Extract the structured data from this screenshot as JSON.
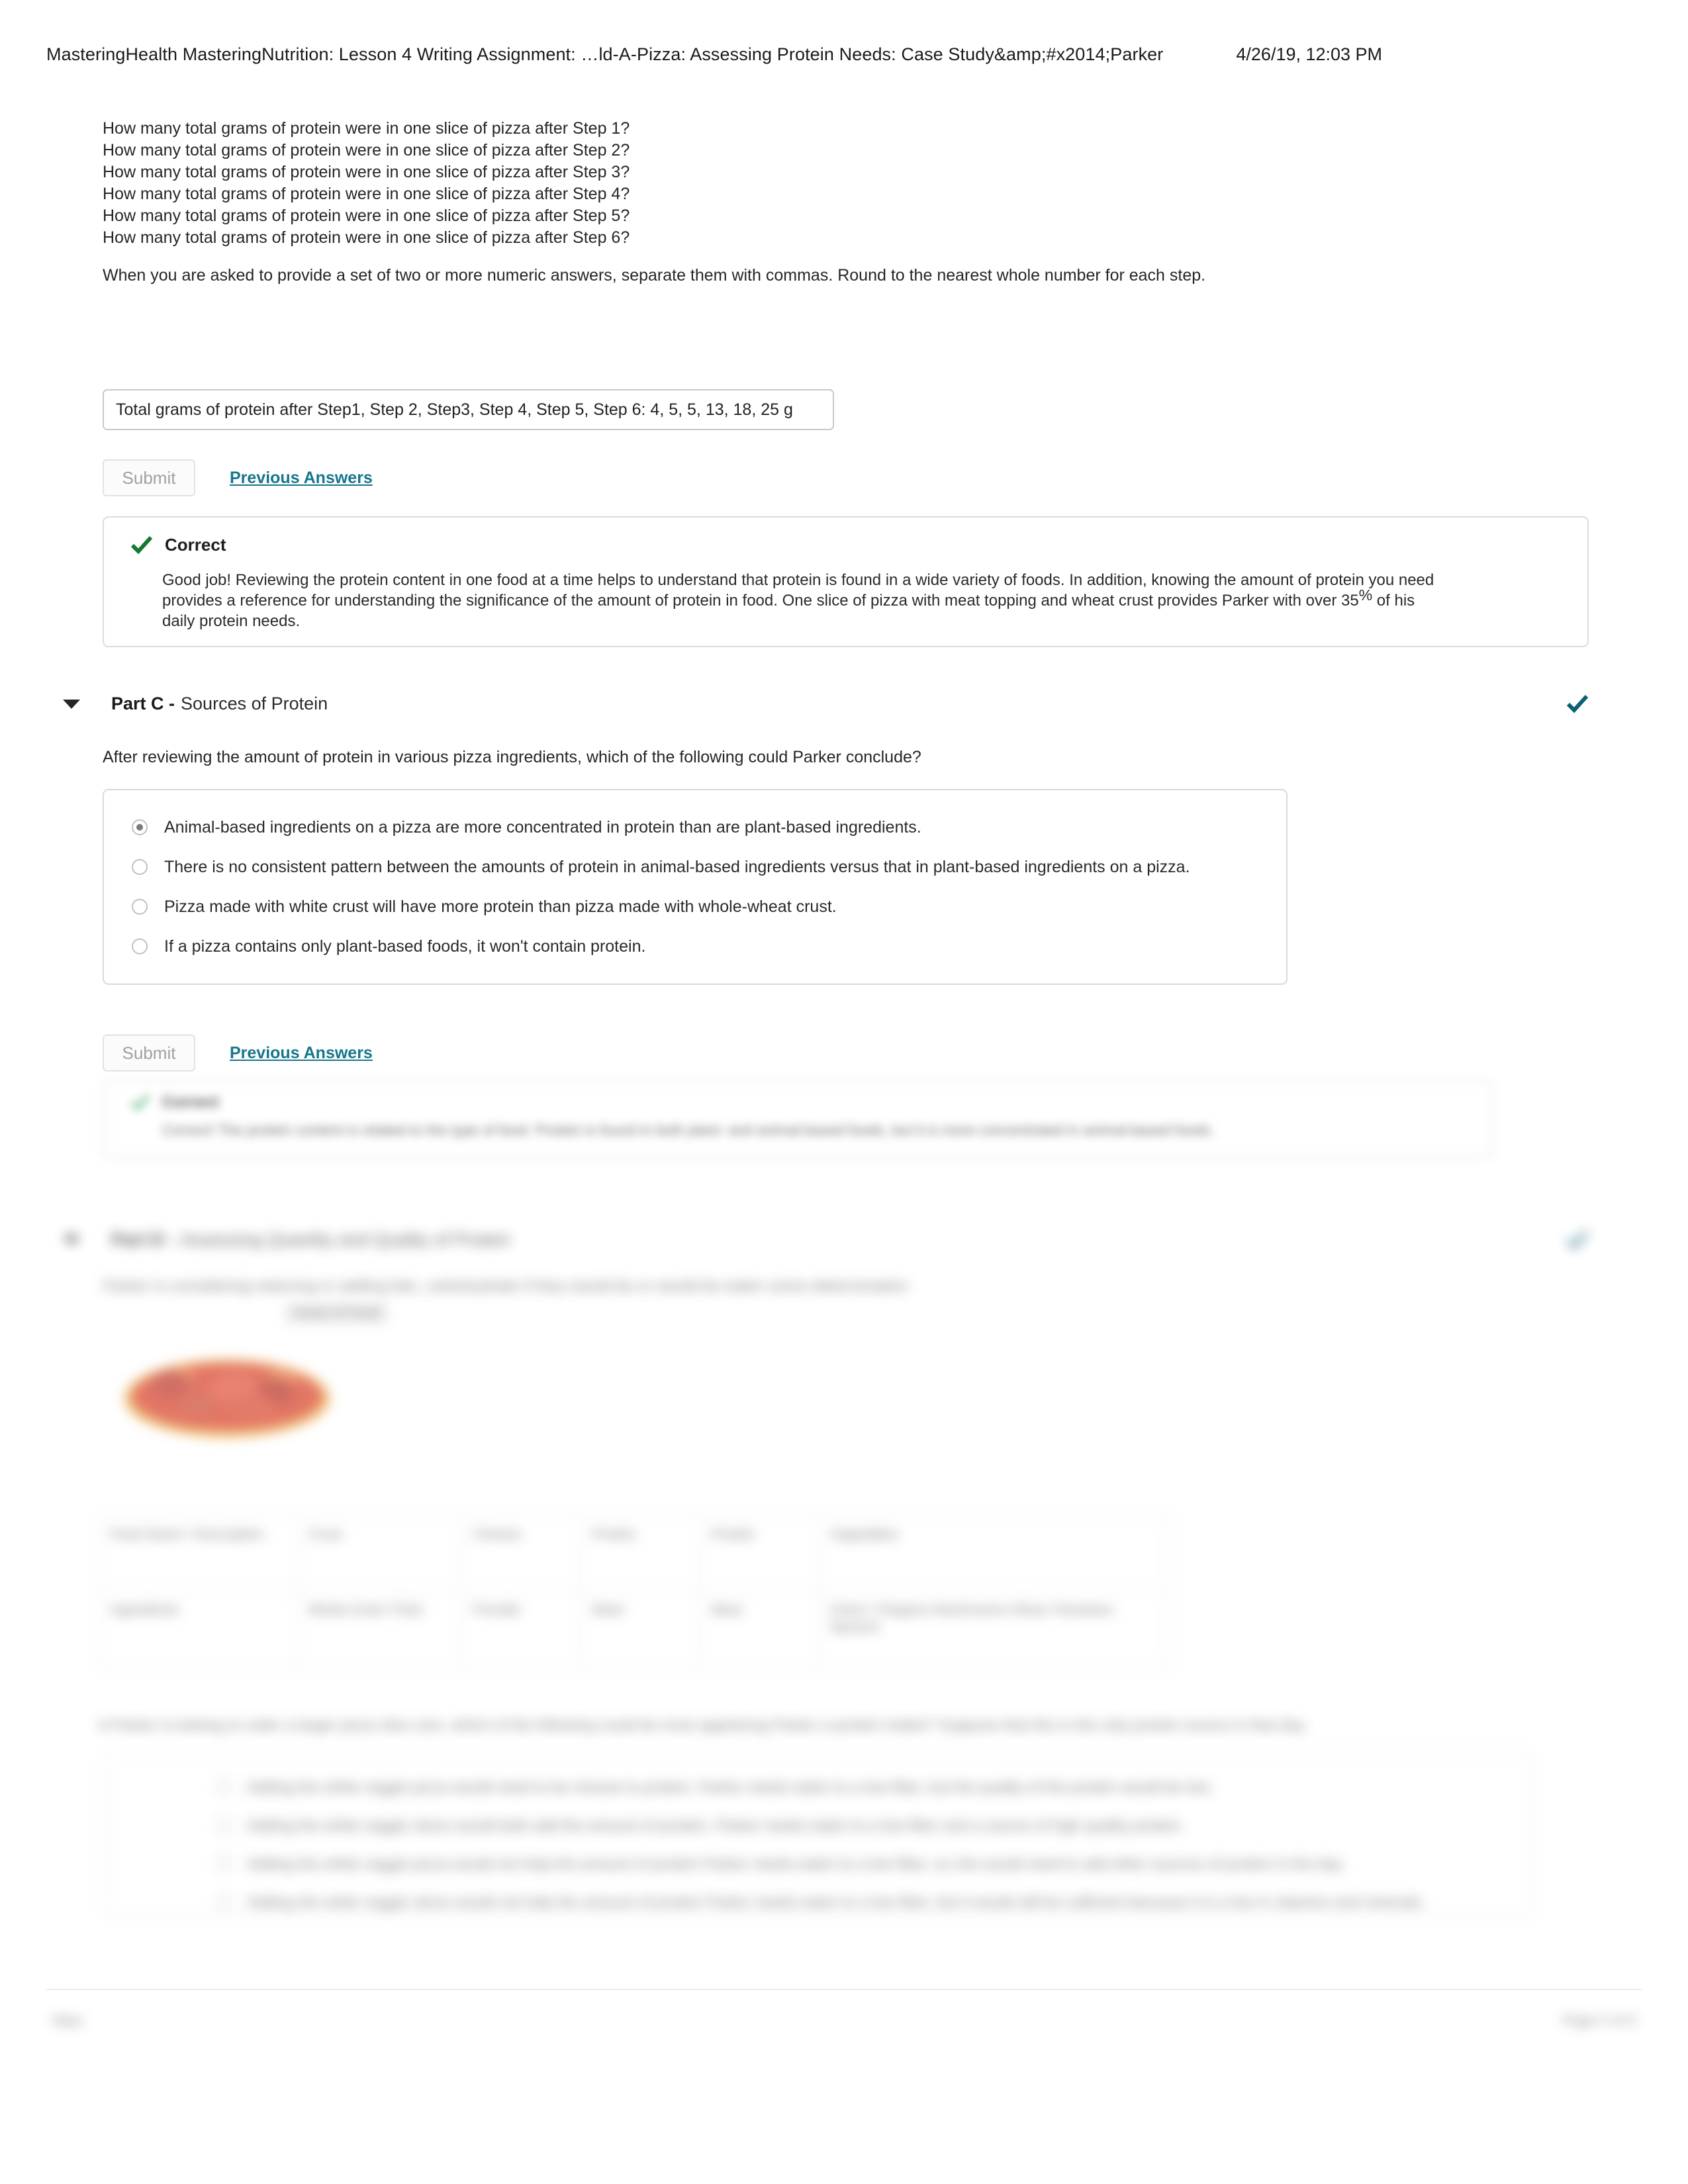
{
  "print_header": {
    "title": "MasteringHealth MasteringNutrition: Lesson 4 Writing Assignment: …ld-A-Pizza: Assessing Protein Needs: Case Study&amp;#x2014;Parker",
    "date": "4/26/19, 12:03 PM"
  },
  "part_b": {
    "questions": [
      "How many total grams of protein were in one slice of pizza after Step 1?",
      "How many total grams of protein were in one slice of pizza after Step 2?",
      "How many total grams of protein were in one slice of pizza after Step 3?",
      "How many total grams of protein were in one slice of pizza after Step 4?",
      "How many total grams of protein were in one slice of pizza after Step 5?",
      "How many total grams of protein were in one slice of pizza after Step 6?"
    ],
    "note": "When you are asked to provide a set of two or more numeric answers, separate them with commas. Round to the nearest whole number for each step.",
    "answer_value": "Total grams of protein after Step1, Step 2, Step3, Step 4, Step 5, Step 6: 4, 5, 5, 13, 18, 25 g",
    "answer_placeholder": "",
    "submit_label": "Submit",
    "previous_answers_label": "Previous Answers",
    "feedback": {
      "status": "Correct",
      "body_1": "Good job! Reviewing the protein content in one food at a time helps to understand that protein is found in a wide variety of foods. In addition, knowing the amount of protein you need",
      "body_2": "provides a reference for understanding the significance of the amount of protein in food. One slice of pizza with meat topping and wheat crust provides Parker with over 35",
      "pct_sign": "%",
      "body_3": " of his",
      "body_4": "daily protein needs."
    }
  },
  "part_c": {
    "label": "Part C -",
    "title": "Sources of Protein",
    "status_icon": "check-icon",
    "question": "After reviewing the amount of protein in various pizza ingredients, which of the following could Parker conclude?",
    "choices": [
      {
        "text": "Animal-based ingredients on a pizza are more concentrated in protein than are plant-based ingredients.",
        "selected": true
      },
      {
        "text": "There is no consistent pattern between the amounts of protein in animal-based ingredients versus that in plant-based ingredients on a pizza.",
        "selected": false
      },
      {
        "text": "Pizza made with white crust will have more protein than pizza made with whole-wheat crust.",
        "selected": false
      },
      {
        "text": "If a pizza contains only plant-based foods, it won't contain protein.",
        "selected": false
      }
    ],
    "submit_label": "Submit",
    "previous_answers_label": "Previous Answers",
    "feedback": {
      "status": "Correct",
      "body": "Correct! The protein content is related to the type of food. Protein is found in both plant- and animal-based foods, but it is more concentrated in animal-based foods."
    }
  },
  "part_d": {
    "label": "Part D -",
    "title": "Assessing Quantity and Quality of Protein",
    "question": "Parker is considering reducing or adding fats, carbohydrate if they would be or would be eaten some determination",
    "sub_note": "meal of food",
    "image_alt": "pizza-photo",
    "table": {
      "headers": [
        "Food Name / Description",
        "Crust",
        "Cheese",
        "Protein",
        "Protein",
        "Vegetables"
      ],
      "rows": [
        [
          "Ingredients",
          "Whole-Grain Thick",
          "Provide",
          "Meat",
          "Meat",
          "Onion / Peppers\nMushrooms\nOlives\nTomatoes\nSpinach"
        ]
      ]
    },
    "question_2": "A Parker is looking to order a larger pizza slice size, which of the following could be most appetizing Parker a protein intake? Suppose that this is the only protein source in that day.",
    "choices": [
      {
        "text": "Adding the white veggie pizza would need to be choose to protein. Parker needs eaten to a low fiber, but the quality of the protein would be low.",
        "selected": false
      },
      {
        "text": "Adding the white veggie slices would both add the amount of protein. Parker needs eaten to a low fiber and a source of high quality protein.",
        "selected": false
      },
      {
        "text": "Adding the white veggie pizza would not help the amount of protein Parker needs eaten to a low fiber, so she would need to add other sources of protein in the day.",
        "selected": false
      },
      {
        "text": "Adding the white veggie slices would not help the amount of protein Parker needs eaten to a low fiber, but it would still be sufficient because it is a low in vitamins and minerals.",
        "selected": false
      }
    ]
  },
  "footer": {
    "left": "https",
    "right": "Page 4 of 5"
  },
  "colors": {
    "link": "#16768c",
    "check_green": "#127a2e",
    "check_teal": "#0d6073",
    "border": "#dcdcdc"
  }
}
